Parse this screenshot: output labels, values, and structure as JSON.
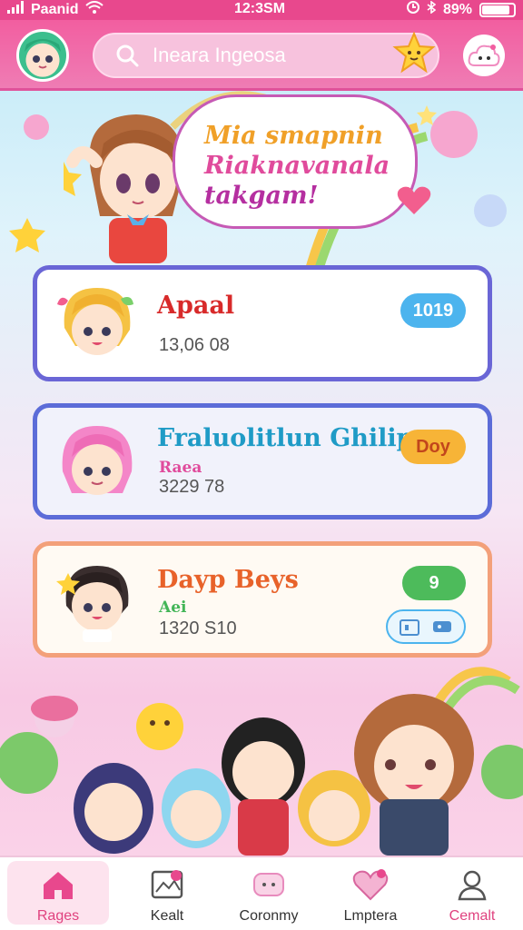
{
  "status_bar": {
    "carrier": "Paanid",
    "time": "12:3SM",
    "battery": "89%",
    "battery_level": 0.89
  },
  "header": {
    "search_placeholder": "Ineara Ingeosa",
    "icons": [
      "avatar",
      "search-icon",
      "star-icon",
      "profile-icon"
    ]
  },
  "hero": {
    "bubble_lines": [
      "Mia smapnin",
      "Riaknavanala",
      "takgam!"
    ]
  },
  "cards": [
    {
      "title": "Apaal",
      "subtitle": "",
      "meta": "13,06 08",
      "badge": "1019",
      "accent": "#6a66d6"
    },
    {
      "title": "Fraluolitlun Ghilip",
      "subtitle": "Raea",
      "meta": "3229 78",
      "badge": "Doy",
      "accent": "#5c6cd8"
    },
    {
      "title": "Dayp Beys",
      "subtitle": "Aei",
      "meta": "1320 S10",
      "badge": "9",
      "accent": "#f3a07a"
    }
  ],
  "tabbar": {
    "tabs": [
      {
        "label": "Rages",
        "icon": "home-icon",
        "active": true
      },
      {
        "label": "Kealt",
        "icon": "map-icon",
        "active": false
      },
      {
        "label": "Coronmy",
        "icon": "chat-icon",
        "active": false
      },
      {
        "label": "Lmptera",
        "icon": "heart-icon",
        "active": false
      },
      {
        "label": "Cemalt",
        "icon": "user-icon",
        "active": false
      }
    ]
  },
  "colors": {
    "brand_pink": "#e8488d",
    "accent_blue": "#4cb4ee",
    "accent_green": "#4dbb5b",
    "accent_orange": "#f7b437"
  }
}
